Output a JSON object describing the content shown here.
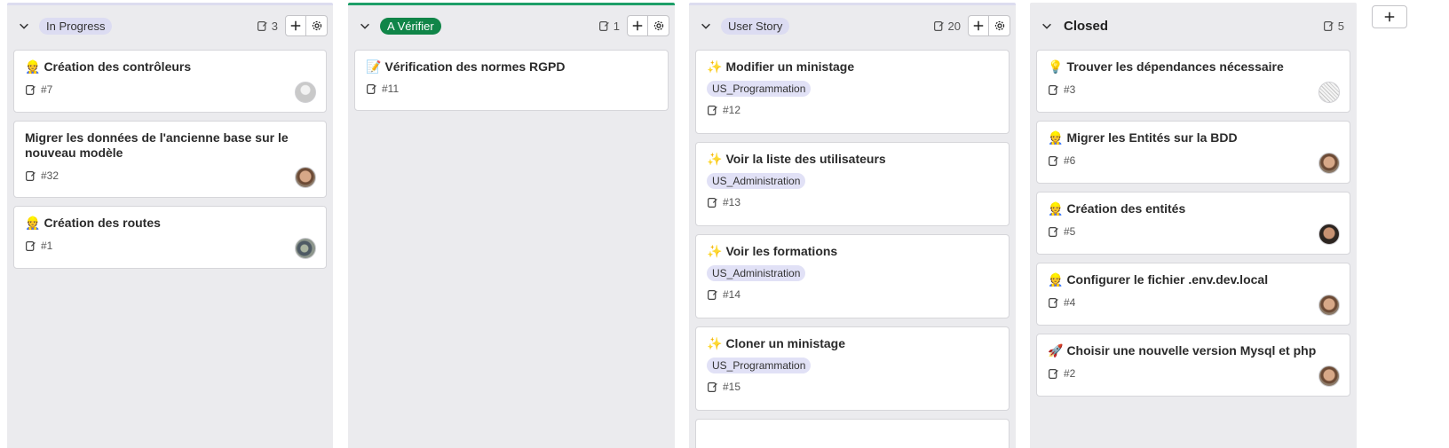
{
  "columns": [
    {
      "title": "In Progress",
      "count": "3",
      "cards": [
        {
          "emoji": "👷",
          "title": "Création des contrôleurs",
          "id": "#7",
          "avatar": "gray"
        },
        {
          "emoji": "",
          "title": "Migrer les données de l'ancienne base sur le nouveau modèle",
          "id": "#32",
          "avatar": "face1"
        },
        {
          "emoji": "👷",
          "title": "Création des routes",
          "id": "#1",
          "avatar": "face2"
        }
      ]
    },
    {
      "title": "A Vérifier",
      "count": "1",
      "cards": [
        {
          "emoji": "📝",
          "title": "Vérification des normes RGPD",
          "id": "#11",
          "avatar": ""
        }
      ]
    },
    {
      "title": "User Story",
      "count": "20",
      "cards": [
        {
          "emoji": "✨",
          "title": "Modifier un ministage",
          "label": "US_Programmation",
          "id": "#12"
        },
        {
          "emoji": "✨",
          "title": "Voir la liste des utilisateurs",
          "label": "US_Administration",
          "id": "#13"
        },
        {
          "emoji": "✨",
          "title": "Voir les formations",
          "label": "US_Administration",
          "id": "#14"
        },
        {
          "emoji": "✨",
          "title": "Cloner un ministage",
          "label": "US_Programmation",
          "id": "#15"
        }
      ]
    },
    {
      "title": "Closed",
      "count": "5",
      "cards": [
        {
          "emoji": "💡",
          "title": "Trouver les dépendances nécessaire",
          "id": "#3",
          "avatar": "noise"
        },
        {
          "emoji": "👷",
          "title": "Migrer les Entités sur la BDD",
          "id": "#6",
          "avatar": "face1"
        },
        {
          "emoji": "👷",
          "title": "Création des entités",
          "id": "#5",
          "avatar": "face3"
        },
        {
          "emoji": "👷",
          "title": "Configurer le fichier .env.dev.local",
          "id": "#4",
          "avatar": "face1"
        },
        {
          "emoji": "🚀",
          "title": "Choisir une nouvelle version Mysql et php",
          "id": "#2",
          "avatar": "face1"
        }
      ]
    }
  ],
  "colors": {
    "column_bg": "#ebebee",
    "accent_green": "#108548",
    "label_bg": "#e1e1f6"
  },
  "icons": {
    "collapse": "chevron-down-icon",
    "count": "issues-icon",
    "add": "plus-icon",
    "settings": "gear-icon",
    "issue": "issue-icon"
  }
}
